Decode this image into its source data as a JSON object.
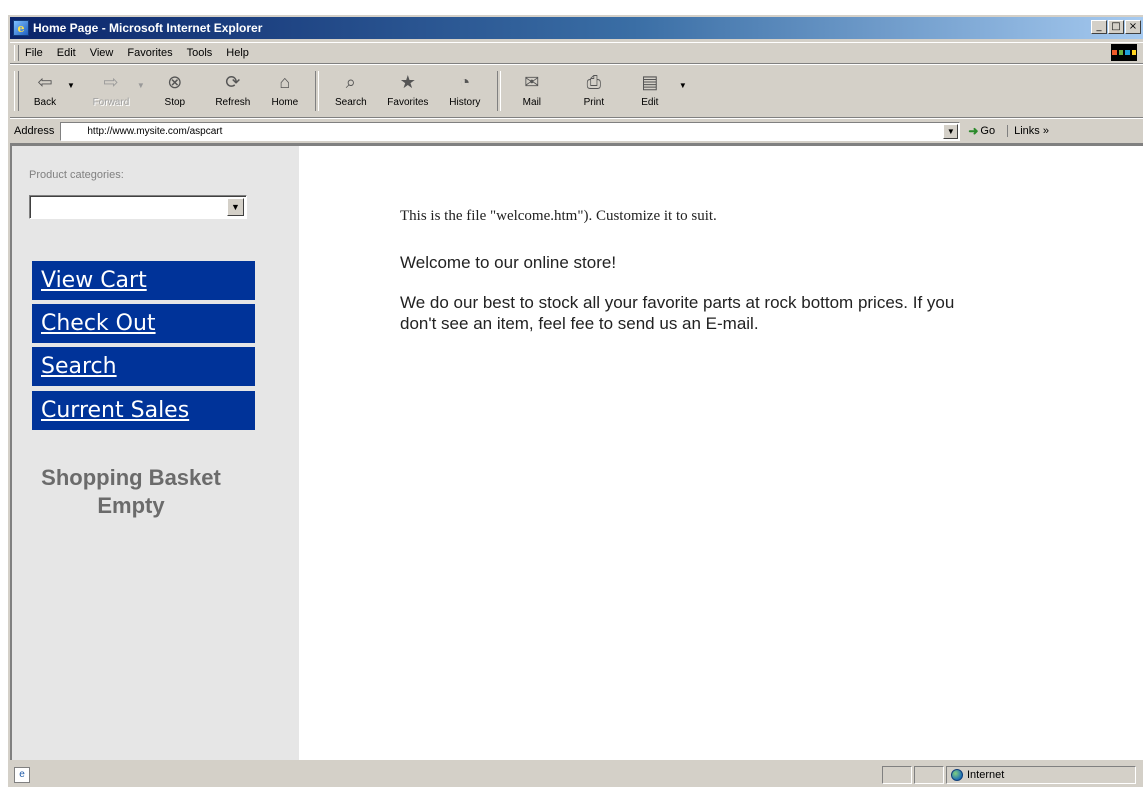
{
  "window": {
    "title": "Home Page - Microsoft Internet Explorer"
  },
  "title_buttons": [
    "_",
    "□",
    "×"
  ],
  "menu": {
    "items": [
      "File",
      "Edit",
      "View",
      "Favorites",
      "Tools",
      "Help"
    ]
  },
  "toolbar": {
    "back": "Back",
    "forward": "Forward",
    "stop": "Stop",
    "refresh": "Refresh",
    "home": "Home",
    "search": "Search",
    "favorites": "Favorites",
    "history": "History",
    "mail": "Mail",
    "print": "Print",
    "edit": "Edit"
  },
  "address": {
    "label": "Address",
    "url": "http://www.mysite.com/aspcart",
    "go": "Go",
    "links": "Links »"
  },
  "sidebar": {
    "category_label": "Product categories:",
    "category_value": "",
    "nav": [
      "View Cart",
      "Check Out",
      "Search",
      "Current Sales"
    ],
    "basket_line1": "Shopping Basket",
    "basket_line2": "Empty",
    "nav_color": "#003399"
  },
  "main": {
    "note": "This is the file \"welcome.htm\"). Customize it to suit.",
    "welcome": "Welcome to our online store!",
    "body": "We do our best to stock all your favorite parts at rock bottom prices. If you don't see an item, feel fee to send us an E-mail."
  },
  "status": {
    "zone": "Internet"
  },
  "icons": {
    "back": "back-arrow-icon",
    "forward": "forward-arrow-icon",
    "stop": "stop-icon",
    "refresh": "refresh-icon",
    "home": "home-icon",
    "search": "search-icon",
    "favorites": "favorites-icon",
    "history": "history-icon",
    "mail": "mail-icon",
    "print": "print-icon",
    "edit": "edit-icon",
    "go": "go-arrow-icon",
    "zone": "internet-globe-icon"
  }
}
